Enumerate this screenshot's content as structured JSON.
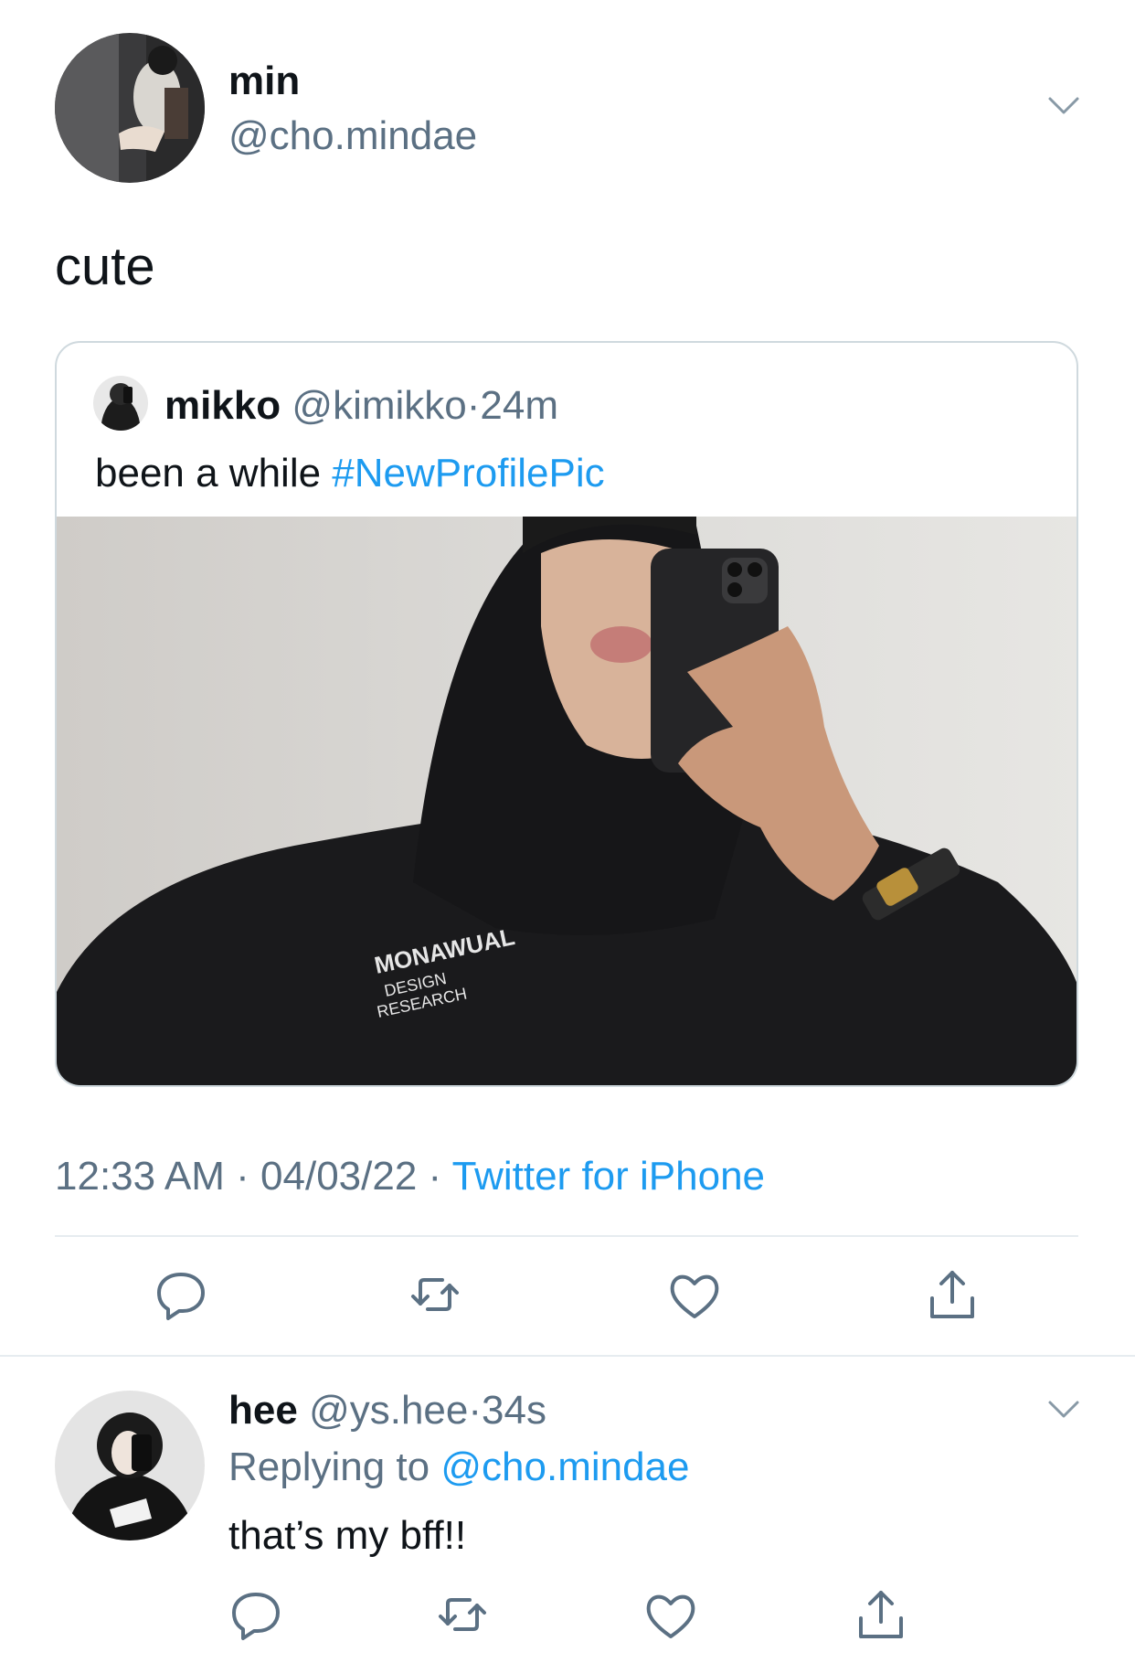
{
  "main_tweet": {
    "author_name": "min",
    "author_handle": "@cho.mindae",
    "text": "cute",
    "time": "12:33 AM",
    "date": "04/03/22",
    "source": "Twitter for iPhone",
    "separator": "·"
  },
  "quoted_tweet": {
    "author_name": "mikko",
    "author_handle": "@kimikko",
    "age": "24m",
    "text": "been a while ",
    "hashtag": "#NewProfilePic",
    "separator": "·"
  },
  "reply_tweet": {
    "author_name": "hee",
    "author_handle": "@ys.hee",
    "age": "34s",
    "replying_prefix": "Replying to ",
    "replying_to": "@cho.mindae",
    "text": "that’s my bff!!",
    "separator": "·"
  },
  "actions": [
    "reply-icon",
    "retweet-icon",
    "like-icon",
    "share-icon"
  ],
  "colors": {
    "text": "#0f1419",
    "secondary": "#5b7083",
    "link": "#1d9bf0",
    "divider": "#e6ecf0",
    "card_border": "#cfd9de"
  }
}
